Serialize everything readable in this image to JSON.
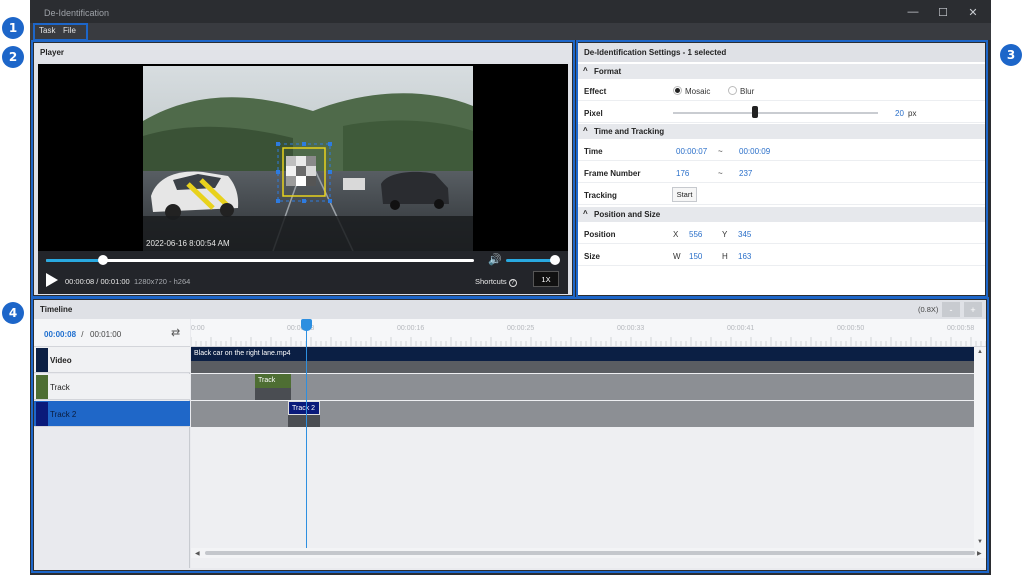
{
  "window": {
    "title": "De-Identification",
    "minimize_glyph": "—",
    "maximize_glyph": "☐",
    "close_glyph": "✕"
  },
  "callouts": [
    "1",
    "2",
    "3",
    "4"
  ],
  "menu": {
    "items": [
      "Task",
      "File"
    ]
  },
  "player": {
    "title": "Player",
    "timestamp": "2022-06-16 8:00:54 AM",
    "time_current": "00:00:08",
    "time_total": "00:01:00",
    "time_separator": " / ",
    "resolution": "1280x720 - h264",
    "shortcuts_label": "Shortcuts",
    "shortcuts_icon": "?",
    "speed_label": "1X",
    "progress_fraction": 0.133,
    "volume_fraction": 1.0,
    "volume_icon": "🔊"
  },
  "settings": {
    "title": "De-Identification Settings - 1 selected",
    "sections": {
      "format": "Format",
      "time_tracking": "Time and Tracking",
      "position_size": "Position and Size"
    },
    "effect": {
      "label": "Effect",
      "options": [
        "Mosaic",
        "Blur"
      ],
      "selected": "Mosaic"
    },
    "pixel": {
      "label": "Pixel",
      "value": "20",
      "unit": "px",
      "slider_fraction": 0.4
    },
    "time": {
      "label": "Time",
      "start": "00:00:07",
      "sep": "~",
      "end": "00:00:09"
    },
    "frame": {
      "label": "Frame Number",
      "start": "176",
      "sep": "~",
      "end": "237"
    },
    "tracking": {
      "label": "Tracking",
      "button": "Start"
    },
    "position": {
      "label": "Position",
      "x_label": "X",
      "x": "556",
      "y_label": "Y",
      "y": "345"
    },
    "size": {
      "label": "Size",
      "w_label": "W",
      "w": "150",
      "h_label": "H",
      "h": "163"
    },
    "collapse_glyph": "^"
  },
  "timeline": {
    "title": "Timeline",
    "zoom": "(0.8X)",
    "zoom_out": "-",
    "zoom_in": "+",
    "current": "00:00:08",
    "separator": " / ",
    "total": "00:01:00",
    "swap_icon": "⇄",
    "ruler_ticks": [
      "0:00",
      "00:00:08",
      "00:00:16",
      "00:00:25",
      "00:00:33",
      "00:00:41",
      "00:00:50",
      "00:00:58"
    ],
    "tracks": [
      {
        "name": "Video",
        "color": "#0b1f44"
      },
      {
        "name": "Track",
        "color": "#4e6e33"
      },
      {
        "name": "Track 2",
        "color": "#0a1a7a"
      }
    ],
    "clips": {
      "video": "Black car on the right lane.mp4",
      "track": "Track",
      "track2": "Track 2"
    },
    "scroll_up": "▲",
    "scroll_down": "▼",
    "scroll_left": "◀",
    "scroll_right": "▶"
  }
}
